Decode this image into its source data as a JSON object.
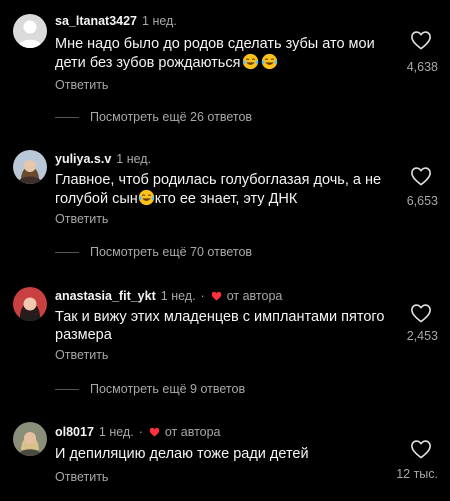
{
  "colors": {
    "background": "#000000",
    "text": "#f5f5f5",
    "secondary": "#a8a8a8",
    "heart_red": "#ff3040"
  },
  "comments": [
    {
      "username": "sa_ltanat3427",
      "time": "1 нед.",
      "text": "Мне надо было до родов сделать зубы  ато мои дети без зубов рождаються",
      "emoji": [
        "face-with-tears-of-joy-icon",
        "face-with-tears-of-joy-icon"
      ],
      "reply_label": "Ответить",
      "likes": "4,638",
      "more_replies": "Посмотреть ещё 26 ответов"
    },
    {
      "username": "yuliya.s.v",
      "time": "1 нед.",
      "text_before_emoji": "Главное, чтоб родилась голубоглазая дочь, а не голубой сын",
      "text_after_emoji": "кто ее знает, эту ДНК",
      "emoji": [
        "face-with-tears-of-joy-icon"
      ],
      "reply_label": "Ответить",
      "likes": "6,653",
      "more_replies": "Посмотреть ещё 70 ответов"
    },
    {
      "username": "anastasia_fit_ykt",
      "time": "1 нед.",
      "separator": "·",
      "author_label": "от автора",
      "text": "Так и вижу этих младенцев с имплантами пятого размера",
      "reply_label": "Ответить",
      "likes": "2,453",
      "more_replies": "Посмотреть ещё 9 ответов"
    },
    {
      "username": "ol8017",
      "time": "1 нед.",
      "separator": "·",
      "author_label": "от автора",
      "text": "И депиляцию делаю тоже ради детей",
      "reply_label": "Ответить",
      "likes": "12 тыс."
    }
  ]
}
